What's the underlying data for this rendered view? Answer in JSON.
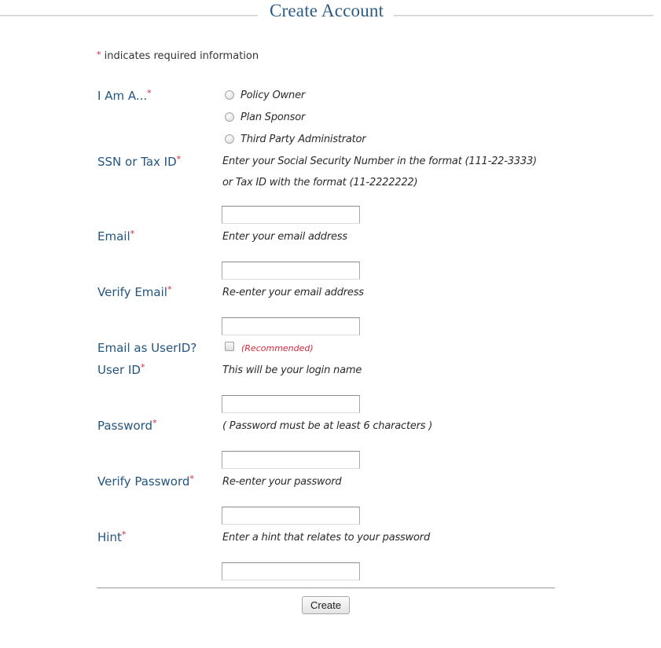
{
  "header": {
    "title": "Create Account"
  },
  "required_note": {
    "marker": "*",
    "text": " indicates required information"
  },
  "colors": {
    "label": "#24557f",
    "required": "#d5283c",
    "title": "#2d5b84"
  },
  "form": {
    "role": {
      "label": "I Am A...",
      "required_marker": "*",
      "options": [
        {
          "label": "Policy Owner",
          "selected": false
        },
        {
          "label": "Plan Sponsor",
          "selected": false
        },
        {
          "label": "Third Party Administrator",
          "selected": false
        }
      ]
    },
    "ssn": {
      "label": "SSN or Tax ID",
      "required_marker": "*",
      "hint_line1": "Enter your Social Security Number in the format (111-22-3333)",
      "hint_line2": "or Tax ID with the format (11-2222222)",
      "value": "",
      "placeholder": ""
    },
    "email": {
      "label": "Email",
      "required_marker": "*",
      "hint": "Enter your email address",
      "value": "",
      "placeholder": ""
    },
    "verify_email": {
      "label": "Verify Email",
      "required_marker": "*",
      "hint": "Re-enter your email address",
      "value": "",
      "placeholder": ""
    },
    "email_as_userid": {
      "label": "Email as UserID?",
      "checked": false,
      "note": "(Recommended)"
    },
    "user_id": {
      "label": "User ID",
      "required_marker": "*",
      "hint": "This will be your login name",
      "value": "",
      "placeholder": ""
    },
    "password": {
      "label": "Password",
      "required_marker": "*",
      "hint": "( Password must be at least 6 characters )",
      "value": "",
      "placeholder": ""
    },
    "verify_password": {
      "label": "Verify Password",
      "required_marker": "*",
      "hint": "Re-enter your password",
      "value": "",
      "placeholder": ""
    },
    "hint_field": {
      "label": "Hint",
      "required_marker": "*",
      "hint": "Enter a hint that relates to your password",
      "value": "",
      "placeholder": ""
    }
  },
  "actions": {
    "create_label": "Create"
  }
}
